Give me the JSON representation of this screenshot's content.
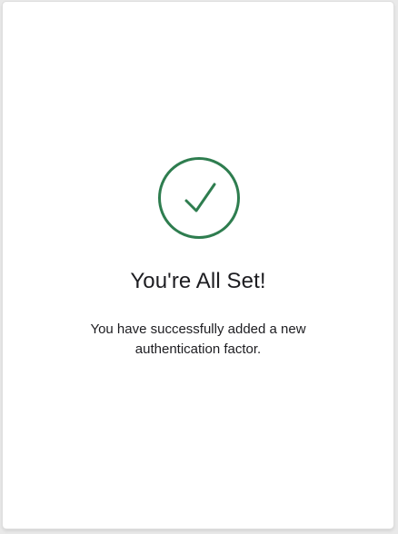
{
  "success": {
    "icon": "checkmark-circle-icon",
    "accent_color": "#2e7d4f",
    "title": "You're All Set!",
    "message": "You have successfully added a new authentication factor."
  }
}
